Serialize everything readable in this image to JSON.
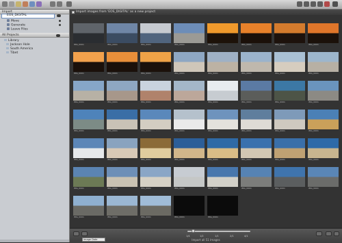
{
  "toolbar": {
    "buttons": [
      "toolbar-button",
      "toolbar-button",
      "toolbar-button",
      "toolbar-button",
      "toolbar-button",
      "toolbar-button",
      "toolbar-button",
      "toolbar-button"
    ]
  },
  "sidebar": {
    "import_header": "Import",
    "device_label": "EOS_DIGITAL",
    "device_items": [
      "Move",
      "Generate",
      "Leave Files"
    ],
    "projects_header": "All Projects",
    "library_items": [
      "Library",
      "Jackson Hole",
      "South America",
      "Tibet"
    ]
  },
  "browser": {
    "import_checkbox_label": "Import images from 'EOS_DIGITAL' as a new project",
    "thumb_caption": "IMG_0001",
    "footer": {
      "sort_label": "Image Date",
      "count_label": "Import all 51 Images",
      "zoom_ticks": [
        "1/4",
        "1/2",
        "1/1",
        "2/1",
        "4/1"
      ]
    },
    "thumbnails": [
      [
        "#5f646a",
        "#2a2d31"
      ],
      [
        "#6f86a6",
        "#3b4c62"
      ],
      [
        "#c6cad0",
        "#50647d"
      ],
      [
        "#6d8db8",
        "#9b9a95"
      ],
      [
        "#f09a2c",
        "#1d1209"
      ],
      [
        "#e8812a",
        "#1b1009"
      ],
      [
        "#d47b2d",
        "#1d120c"
      ],
      [
        "#e0762a",
        "#1b110a"
      ],
      [
        "#f2a14c",
        "#1a100a"
      ],
      [
        "#e88f3a",
        "#1a100a"
      ],
      [
        "#efa247",
        "#1b110b"
      ],
      [
        "#8ea7c3",
        "#cfc6b9"
      ],
      [
        "#9fb1c5",
        "#bcb2a4"
      ],
      [
        "#9bb3cb",
        "#bfb8ad"
      ],
      [
        "#a9c0d4",
        "#d6cdbf"
      ],
      [
        "#9db6cc",
        "#b7b0a4"
      ],
      [
        "#86a6c8",
        "#b7b1a5"
      ],
      [
        "#8ea7c2",
        "#a7978a"
      ],
      [
        "#c9d3de",
        "#b0826b"
      ],
      [
        "#a4b7c9",
        "#bca79a"
      ],
      [
        "#e8ecef",
        "#c7ccd1"
      ],
      [
        "#5b7aa3",
        "#5b5d5a"
      ],
      [
        "#3c78a5",
        "#4d5447"
      ],
      [
        "#6a94bd",
        "#8c8a84"
      ],
      [
        "#4e83ba",
        "#7c8b86"
      ],
      [
        "#3a6ea6",
        "#c9c2b6"
      ],
      [
        "#5a88bb",
        "#d3cdc2"
      ],
      [
        "#b5c1cc",
        "#eaeaea"
      ],
      [
        "#6e93bd",
        "#e4e2dc"
      ],
      [
        "#5f7e9d",
        "#dedbd5"
      ],
      [
        "#7e9ab9",
        "#cfc9bf"
      ],
      [
        "#4b80b6",
        "#caa05a"
      ],
      [
        "#5c86b7",
        "#e6e8ea"
      ],
      [
        "#89a3bf",
        "#d8c9b6"
      ],
      [
        "#8b6a38",
        "#e0cc9e"
      ],
      [
        "#2c5e98",
        "#d1b68a"
      ],
      [
        "#2f6aa6",
        "#d9bc86"
      ],
      [
        "#3a71ae",
        "#d2c7b3"
      ],
      [
        "#3a6fa9",
        "#bfa173"
      ],
      [
        "#2e6aa8",
        "#c8b58f"
      ],
      [
        "#5b84b2",
        "#6c7a55"
      ],
      [
        "#6d8fb7",
        "#c9c2b2"
      ],
      [
        "#8aa6c6",
        "#d6d1c5"
      ],
      [
        "#c7ccd2",
        "#c5c7c6"
      ],
      [
        "#4877ad",
        "#d2d0c8"
      ],
      [
        "#5683b4",
        "#7c7d7b"
      ],
      [
        "#3f74ad",
        "#5b5e5f"
      ],
      [
        "#5a86b6",
        "#6b6c6a"
      ],
      [
        "#8fb0d0",
        "#6a6a65"
      ],
      [
        "#9bb7d2",
        "#6e6d67"
      ],
      [
        "#a0bcd7",
        "#6b6a63"
      ],
      [
        "#0b0b0b",
        "#0b0b0b"
      ],
      [
        "#0b0b0b",
        "#0b0b0b"
      ]
    ]
  }
}
